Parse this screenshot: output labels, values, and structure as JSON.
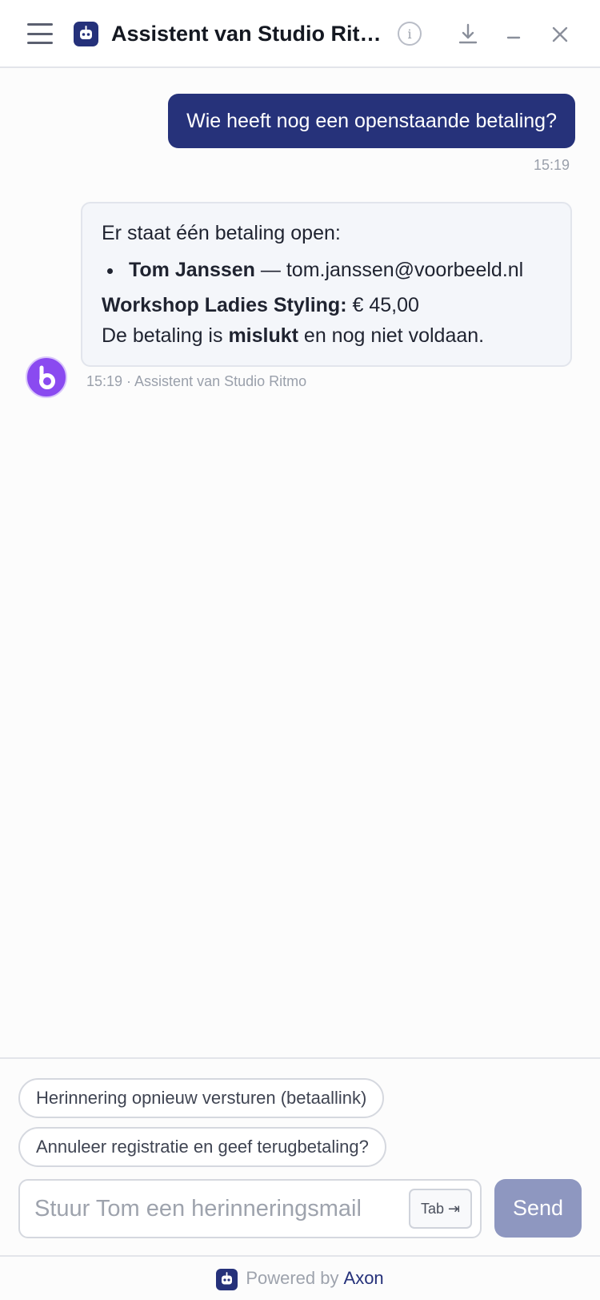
{
  "header": {
    "title": "Assistent van Studio Rit…",
    "info_icon": "info-icon",
    "menu_icon": "hamburger-menu-icon",
    "download_icon": "download-icon",
    "minimize_icon": "minimize-icon",
    "close_icon": "close-icon",
    "info_glyph": "i"
  },
  "messages": {
    "user": {
      "text": "Wie heeft nog een openstaande betaling?",
      "time": "15:19"
    },
    "bot": {
      "intro": "Er staat één betaling open:",
      "item_name": "Tom Janssen",
      "item_separator": " — ",
      "item_email": "tom.janssen@voorbeeld.nl",
      "product_label": "Workshop Ladies Styling:",
      "product_amount": " € 45,00",
      "status_prefix": "De betaling is ",
      "status_bold": "mislukt",
      "status_suffix": " en nog niet voldaan.",
      "meta": "15:19 · Assistent van Studio Ritmo"
    }
  },
  "suggestions": [
    "Herinnering opnieuw versturen (betaallink)",
    "Annuleer registratie en geef terugbetaling?"
  ],
  "composer": {
    "placeholder": "Stuur Tom een herinneringsmail",
    "value": "",
    "tab_hint": "Tab ⇥",
    "send_label": "Send"
  },
  "footer": {
    "powered_by": "Powered by",
    "brand": "Axon"
  },
  "colors": {
    "brand": "#25317a",
    "send_disabled": "#8e97c0",
    "bot_avatar": "#8a4af0"
  }
}
